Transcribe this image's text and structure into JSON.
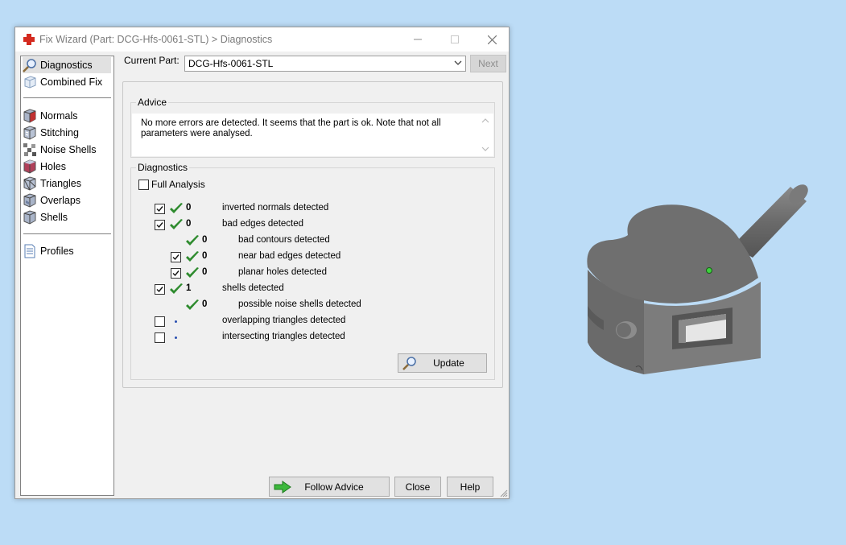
{
  "window": {
    "title": "Fix Wizard (Part: DCG-Hfs-0061-STL) > Diagnostics"
  },
  "sidebar": {
    "items": [
      {
        "label": "Diagnostics",
        "icon": "magnifier-icon",
        "selected": true
      },
      {
        "label": "Combined Fix",
        "icon": "cube-icon"
      },
      {
        "label": "Normals",
        "icon": "cube-normals-icon"
      },
      {
        "label": "Stitching",
        "icon": "cube-stitching-icon"
      },
      {
        "label": "Noise Shells",
        "icon": "noise-shells-icon"
      },
      {
        "label": "Holes",
        "icon": "cube-holes-icon"
      },
      {
        "label": "Triangles",
        "icon": "cube-triangles-icon"
      },
      {
        "label": "Overlaps",
        "icon": "cube-overlaps-icon"
      },
      {
        "label": "Shells",
        "icon": "cube-shells-icon"
      },
      {
        "label": "Profiles",
        "icon": "document-icon"
      }
    ]
  },
  "current_part": {
    "label": "Current Part:",
    "value": "DCG-Hfs-0061-STL"
  },
  "buttons": {
    "next": "Next",
    "update": "Update",
    "follow_advice": "Follow Advice",
    "close": "Close",
    "help": "Help"
  },
  "advice": {
    "title": "Advice",
    "text": "No more errors are detected. It seems that the part is ok. Note that not all parameters were analysed."
  },
  "diagnostics": {
    "title": "Diagnostics",
    "full_analysis_label": "Full Analysis",
    "full_analysis_checked": false,
    "rows": [
      {
        "checkbox": true,
        "checked": true,
        "status": "ok",
        "count": "0",
        "label": "inverted normals detected",
        "indent": 0
      },
      {
        "checkbox": true,
        "checked": true,
        "status": "ok",
        "count": "0",
        "label": "bad edges detected",
        "indent": 0
      },
      {
        "checkbox": false,
        "checked": false,
        "status": "ok",
        "count": "0",
        "label": "bad contours detected",
        "indent": 1
      },
      {
        "checkbox": true,
        "checked": true,
        "status": "ok",
        "count": "0",
        "label": "near bad edges detected",
        "indent": 1
      },
      {
        "checkbox": true,
        "checked": true,
        "status": "ok",
        "count": "0",
        "label": "planar holes detected",
        "indent": 1
      },
      {
        "checkbox": true,
        "checked": true,
        "status": "ok",
        "count": "1",
        "label": "shells detected",
        "indent": 0
      },
      {
        "checkbox": false,
        "checked": false,
        "status": "ok",
        "count": "0",
        "label": "possible noise shells detected",
        "indent": 1
      },
      {
        "checkbox": true,
        "checked": false,
        "status": "pending",
        "count": "",
        "label": "overlapping triangles detected",
        "indent": 0
      },
      {
        "checkbox": true,
        "checked": false,
        "status": "pending",
        "count": "",
        "label": "intersecting triangles detected",
        "indent": 0
      }
    ]
  },
  "colors": {
    "desktop_background": "#bcdcf6",
    "check_green": "#2e8b2e",
    "model_gray": "#6f6f6f"
  }
}
